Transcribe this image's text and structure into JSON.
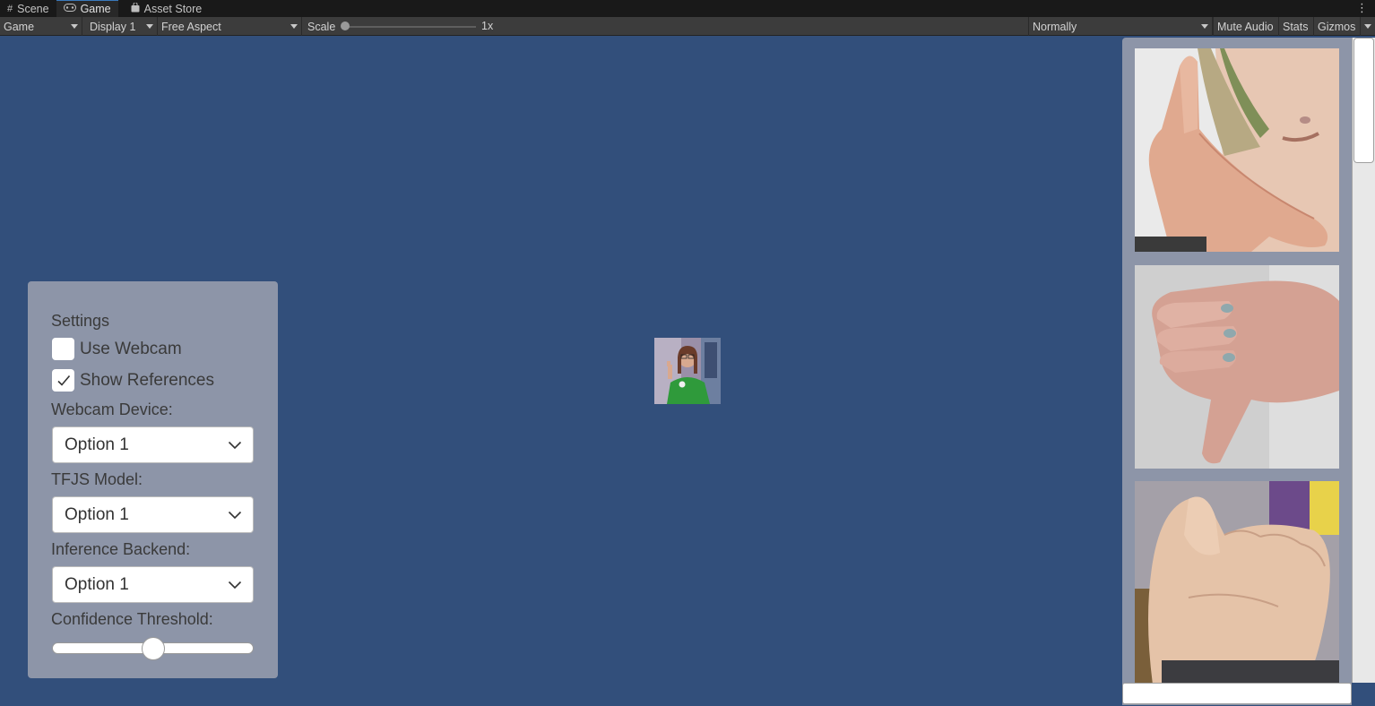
{
  "tabs": [
    {
      "label": "Scene",
      "icon": "grid-icon"
    },
    {
      "label": "Game",
      "icon": "gamepad-icon"
    },
    {
      "label": "Asset Store",
      "icon": "bag-icon"
    }
  ],
  "toolbar": {
    "view_mode": "Game",
    "display": "Display 1",
    "aspect": "Free Aspect",
    "scale_label": "Scale",
    "scale_value": "1x",
    "play_mode": "Normally",
    "mute_audio": "Mute Audio",
    "stats": "Stats",
    "gizmos": "Gizmos"
  },
  "settings": {
    "title": "Settings",
    "use_webcam": {
      "label": "Use Webcam",
      "checked": false
    },
    "show_references": {
      "label": "Show References",
      "checked": true
    },
    "webcam_device": {
      "label": "Webcam Device:",
      "value": "Option 1"
    },
    "tfjs_model": {
      "label": "TFJS Model:",
      "value": "Option 1"
    },
    "inference_backend": {
      "label": "Inference Backend:",
      "value": "Option 1"
    },
    "confidence_threshold": {
      "label": "Confidence Threshold:",
      "value": 0.5
    }
  },
  "references": [
    {
      "name": "call-gesture-image"
    },
    {
      "name": "thumbs-down-image"
    },
    {
      "name": "fist-image"
    }
  ],
  "colors": {
    "game_background": "#324f7b",
    "panel": "#8d95a8"
  }
}
